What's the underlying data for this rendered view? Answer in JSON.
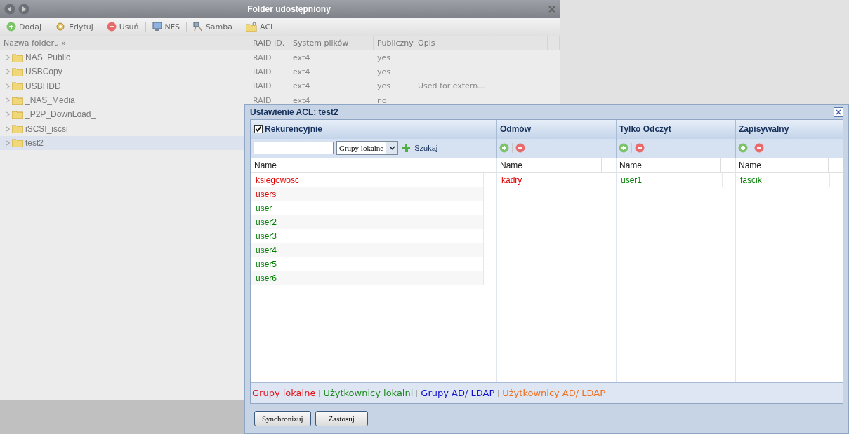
{
  "window": {
    "title": "Folder udostępniony"
  },
  "toolbar": [
    {
      "label": "Dodaj",
      "kind": "add"
    },
    {
      "label": "Edytuj",
      "kind": "edit"
    },
    {
      "label": "Usuń",
      "kind": "remove"
    },
    {
      "label": "NFS",
      "kind": "nfs"
    },
    {
      "label": "Samba",
      "kind": "samba"
    },
    {
      "label": "ACL",
      "kind": "acl"
    }
  ],
  "table": {
    "columns": [
      "Nazwa folderu »",
      "RAID ID.",
      "System plików",
      "Publiczny",
      "Opis"
    ],
    "rows": [
      {
        "cells": [
          "NAS_Public",
          "RAID",
          "ext4",
          "yes"
        ],
        "selected": false
      },
      {
        "cells": [
          "USBCopy",
          "RAID",
          "ext4",
          "yes"
        ],
        "selected": false
      },
      {
        "cells": [
          "USBHDD",
          "RAID",
          "ext4",
          "yes",
          "Used for extern..."
        ],
        "selected": false
      },
      {
        "cells": [
          "_NAS_Media",
          "RAID",
          "ext4",
          "no"
        ],
        "selected": false
      },
      {
        "cells": [
          "_P2P_DownLoad_"
        ],
        "selected": false
      },
      {
        "cells": [
          "iSCSI_iscsi"
        ],
        "selected": false
      },
      {
        "cells": [
          "test2"
        ],
        "selected": true
      }
    ]
  },
  "dialog": {
    "title": "Ustawienie ACL: test2",
    "recursive": {
      "label": "Rekurencyjnie",
      "checked": true
    },
    "search": {
      "filter": "Grupy lokalne",
      "button": "Szukaj"
    },
    "list": {
      "column": "Name",
      "items": [
        {
          "name": "ksiegowosc",
          "color": "#e00000"
        },
        {
          "name": "users",
          "color": "#e00000"
        },
        {
          "name": "user",
          "color": "#008000"
        },
        {
          "name": "user2",
          "color": "#008000"
        },
        {
          "name": "user3",
          "color": "#008000"
        },
        {
          "name": "user4",
          "color": "#008000"
        },
        {
          "name": "user5",
          "color": "#008000"
        },
        {
          "name": "user6",
          "color": "#008000"
        }
      ]
    },
    "permissions": [
      {
        "title": "Odmów",
        "column": "Name",
        "items": [
          {
            "name": "kadry",
            "color": "#e00000"
          }
        ]
      },
      {
        "title": "Tylko Odczyt",
        "column": "Name",
        "items": [
          {
            "name": "user1",
            "color": "#008000"
          }
        ]
      },
      {
        "title": "Zapisywalny",
        "column": "Name",
        "items": [
          {
            "name": "fascik",
            "color": "#008000"
          }
        ]
      }
    ],
    "legend": [
      {
        "label": "Grupy lokalne",
        "color": "#e8101a"
      },
      {
        "label": "Użytkownicy lokalni",
        "color": "#1f8a1f"
      },
      {
        "label": "Grupy AD/ LDAP",
        "color": "#1010c8"
      },
      {
        "label": "Użytkownicy AD/ LDAP",
        "color": "#f07020"
      }
    ],
    "buttons": [
      "Synchronizuj",
      "Zastosuj"
    ]
  }
}
